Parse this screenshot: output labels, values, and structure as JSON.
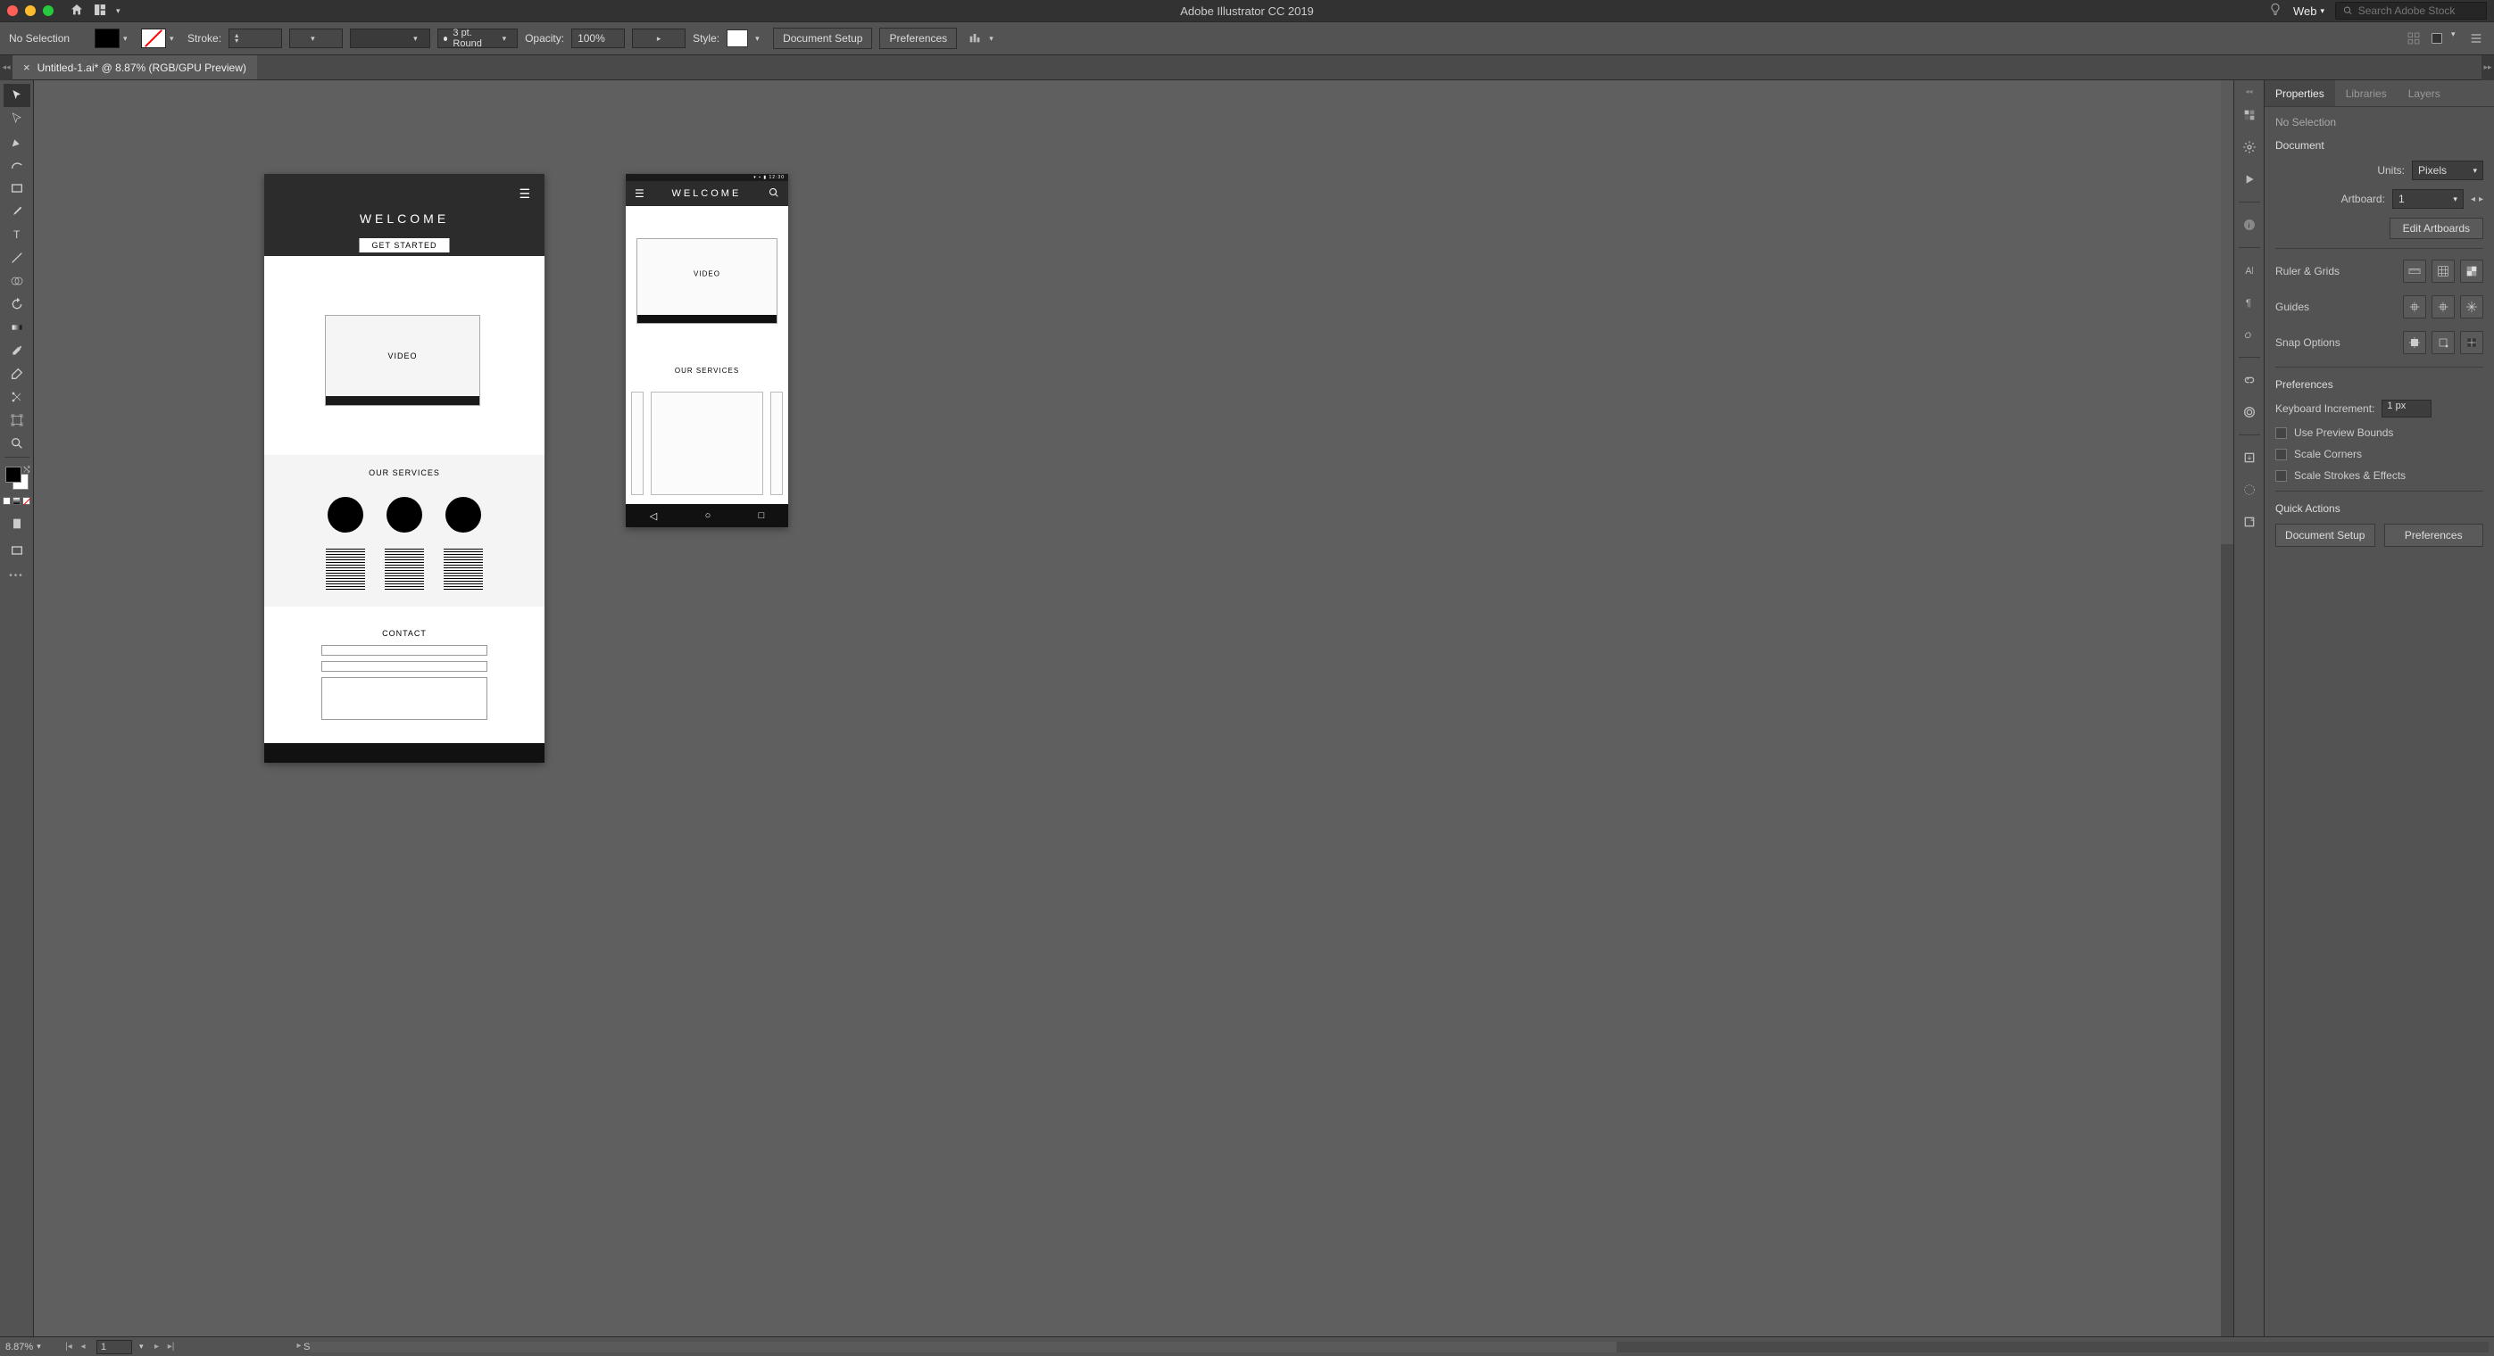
{
  "menubar": {
    "app_title": "Adobe Illustrator CC 2019",
    "workspace": "Web",
    "search_placeholder": "Search Adobe Stock"
  },
  "controlbar": {
    "selection_label": "No Selection",
    "stroke_label": "Stroke:",
    "stroke_width": "",
    "stroke_profile": "3 pt. Round",
    "opacity_label": "Opacity:",
    "opacity_value": "100%",
    "style_label": "Style:",
    "doc_setup_btn": "Document Setup",
    "preferences_btn": "Preferences"
  },
  "tabbar": {
    "doc_tab_close": "×",
    "doc_tab_title": "Untitled-1.ai* @ 8.87% (RGB/GPU Preview)"
  },
  "canvas": {
    "artboard1": {
      "welcome": "WELCOME",
      "get_started": "GET STARTED",
      "video": "VIDEO",
      "our_services": "OUR SERVICES",
      "contact": "CONTACT"
    },
    "artboard2": {
      "status_time": "▾ ▪ ▮ 12:30",
      "welcome": "WELCOME",
      "video": "VIDEO",
      "our_services": "OUR SERVICES"
    }
  },
  "properties": {
    "tabs": {
      "properties": "Properties",
      "libraries": "Libraries",
      "layers": "Layers"
    },
    "no_selection": "No Selection",
    "document_section": "Document",
    "units_label": "Units:",
    "units_value": "Pixels",
    "artboard_label": "Artboard:",
    "artboard_value": "1",
    "edit_artboards": "Edit Artboards",
    "ruler_grids": "Ruler & Grids",
    "guides": "Guides",
    "snap_options": "Snap Options",
    "preferences_section": "Preferences",
    "keyboard_incr_label": "Keyboard Increment:",
    "keyboard_incr_value": "1 px",
    "use_preview_bounds": "Use Preview Bounds",
    "scale_corners": "Scale Corners",
    "scale_strokes": "Scale Strokes & Effects",
    "quick_actions": "Quick Actions",
    "qa_doc_setup": "Document Setup",
    "qa_preferences": "Preferences"
  },
  "statusbar": {
    "zoom": "8.87%",
    "artboard_num": "1",
    "tool": "Selection"
  }
}
